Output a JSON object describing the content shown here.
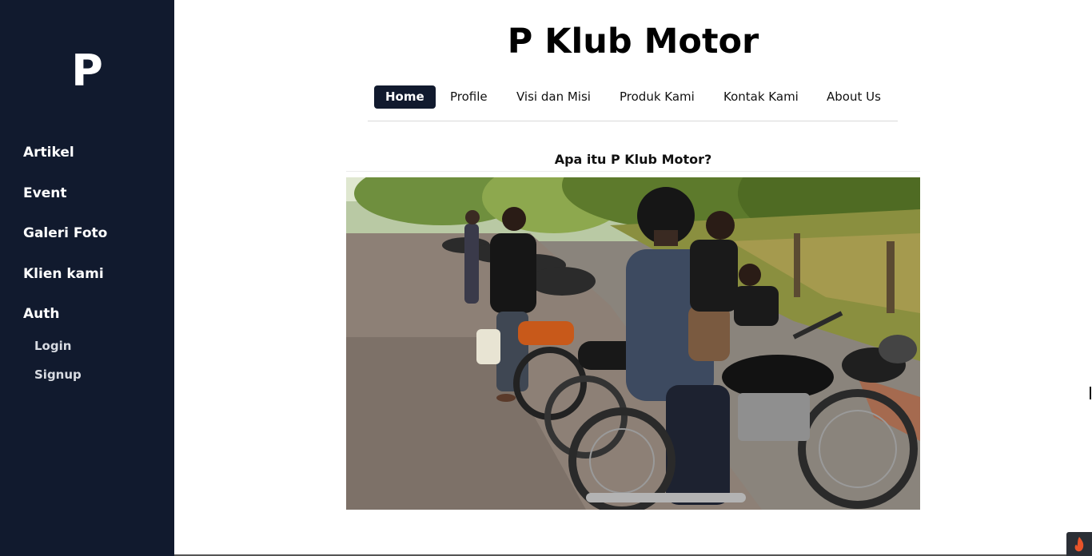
{
  "sidebar": {
    "logo": "P",
    "items": [
      {
        "label": "Artikel"
      },
      {
        "label": "Event"
      },
      {
        "label": "Galeri Foto"
      },
      {
        "label": "Klien kami"
      },
      {
        "label": "Auth"
      }
    ],
    "auth_items": [
      {
        "label": "Login"
      },
      {
        "label": "Signup"
      }
    ]
  },
  "header": {
    "title": "P Klub Motor"
  },
  "nav": {
    "tabs": [
      {
        "label": "Home",
        "active": true
      },
      {
        "label": "Profile"
      },
      {
        "label": "Visi dan Misi"
      },
      {
        "label": "Produk Kami"
      },
      {
        "label": "Kontak Kami"
      },
      {
        "label": "About Us"
      }
    ]
  },
  "content": {
    "section_title": "Apa itu P Klub Motor?",
    "photo_icon": "motorcycle-club-photo"
  },
  "corner": {
    "icon": "flame-icon"
  },
  "colors": {
    "sidebar_bg": "#111a2e",
    "active_tab_bg": "#111a2e",
    "flame": "#e8542a"
  }
}
